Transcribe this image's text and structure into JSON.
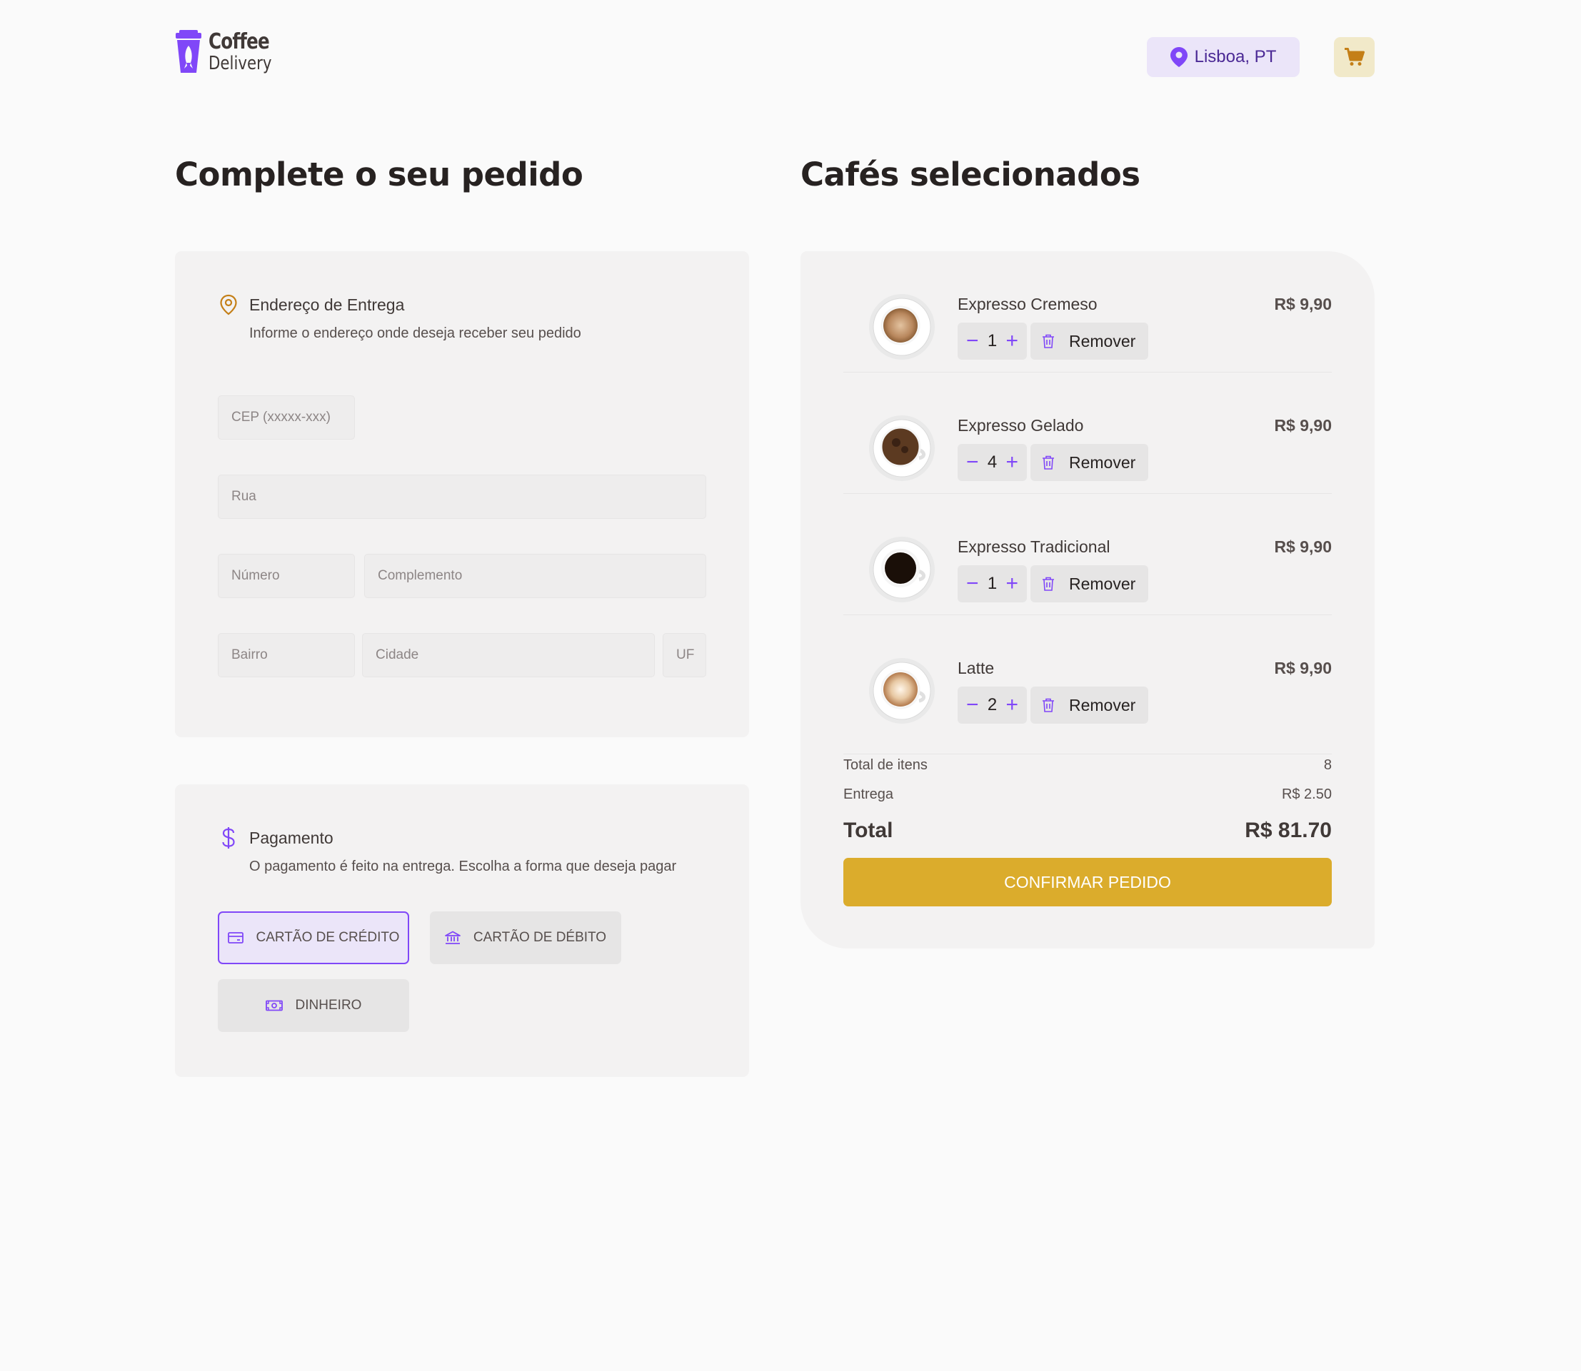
{
  "colors": {
    "purple": "#8047F8",
    "purple_dark": "#4B2995",
    "yellow": "#DBAC2C",
    "yellow_dark": "#C47F17",
    "background": "#FAFAFA",
    "card": "#F3F2F2"
  },
  "header": {
    "logo_line1": "Coffee",
    "logo_line2": "Delivery",
    "logo_icon": "coffee-cup-rocket-icon",
    "location": "Lisboa, PT",
    "location_icon": "map-pin-icon",
    "cart_icon": "shopping-cart-icon"
  },
  "checkout": {
    "title": "Complete o seu pedido",
    "address": {
      "icon": "map-pin-outline-icon",
      "title": "Endereço de Entrega",
      "subtitle": "Informe o endereço onde deseja receber seu pedido",
      "fields": {
        "cep": {
          "placeholder": "CEP (xxxxx-xxx)",
          "value": ""
        },
        "rua": {
          "placeholder": "Rua",
          "value": ""
        },
        "numero": {
          "placeholder": "Número",
          "value": ""
        },
        "complemento": {
          "placeholder": "Complemento",
          "value": ""
        },
        "bairro": {
          "placeholder": "Bairro",
          "value": ""
        },
        "cidade": {
          "placeholder": "Cidade",
          "value": ""
        },
        "uf": {
          "placeholder": "UF",
          "value": ""
        }
      }
    },
    "payment": {
      "icon": "currency-dollar-icon",
      "title": "Pagamento",
      "subtitle": "O pagamento é feito na entrega. Escolha a forma que deseja pagar",
      "options": [
        {
          "label": "CARTÃO DE CRÉDITO",
          "icon": "credit-card-icon",
          "selected": true
        },
        {
          "label": "CARTÃO DE DÉBITO",
          "icon": "bank-icon",
          "selected": false
        },
        {
          "label": "DINHEIRO",
          "icon": "money-icon",
          "selected": false
        }
      ]
    }
  },
  "cart": {
    "title": "Cafés selecionados",
    "remove_label": "Remover",
    "items": [
      {
        "name": "Expresso Cremeso",
        "quantity": "1",
        "price": "R$ 9,90"
      },
      {
        "name": "Expresso Gelado",
        "quantity": "4",
        "price": "R$ 9,90"
      },
      {
        "name": "Expresso Tradicional",
        "quantity": "1",
        "price": "R$ 9,90"
      },
      {
        "name": "Latte",
        "quantity": "2",
        "price": "R$ 9,90"
      }
    ],
    "summary": {
      "items_label": "Total de itens",
      "items_value": "8",
      "delivery_label": "Entrega",
      "delivery_value": "R$ 2.50",
      "total_label": "Total",
      "total_value": "R$ 81.70"
    },
    "confirm_label": "CONFIRMAR PEDIDO"
  }
}
